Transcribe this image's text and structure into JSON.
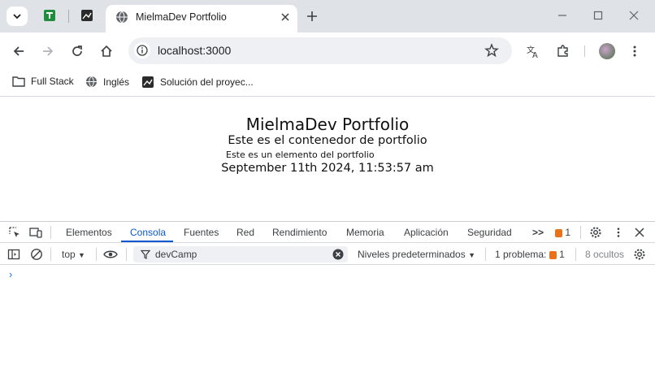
{
  "browser": {
    "active_tab_title": "MielmaDev Portfolio",
    "url": "localhost:3000",
    "bookmarks": [
      {
        "label": "Full Stack",
        "icon": "folder-icon"
      },
      {
        "label": "Inglés",
        "icon": "globe-icon"
      },
      {
        "label": "Solución del proyec...",
        "icon": "page-icon"
      }
    ]
  },
  "page": {
    "title": "MielmaDev Portfolio",
    "subtitle": "Este es el contenedor de portfolio",
    "item": "Este es un elemento del portfolio",
    "date": "September 11th 2024, 11:53:57 am"
  },
  "devtools": {
    "tabs": [
      "Elementos",
      "Consola",
      "Fuentes",
      "Red",
      "Rendimiento",
      "Memoria",
      "Aplicación",
      "Seguridad"
    ],
    "active_tab": "Consola",
    "more": ">>",
    "issues_count": "1",
    "context": "top",
    "filter_value": "devCamp",
    "levels": "Niveles predeterminados",
    "problems_label": "1 problema:",
    "problems_count": "1",
    "hidden": "8 ocultos",
    "prompt": "›"
  },
  "colors": {
    "accent": "#0b57d0",
    "tabstrip": "#dfe3e8",
    "warning": "#e8711a"
  }
}
